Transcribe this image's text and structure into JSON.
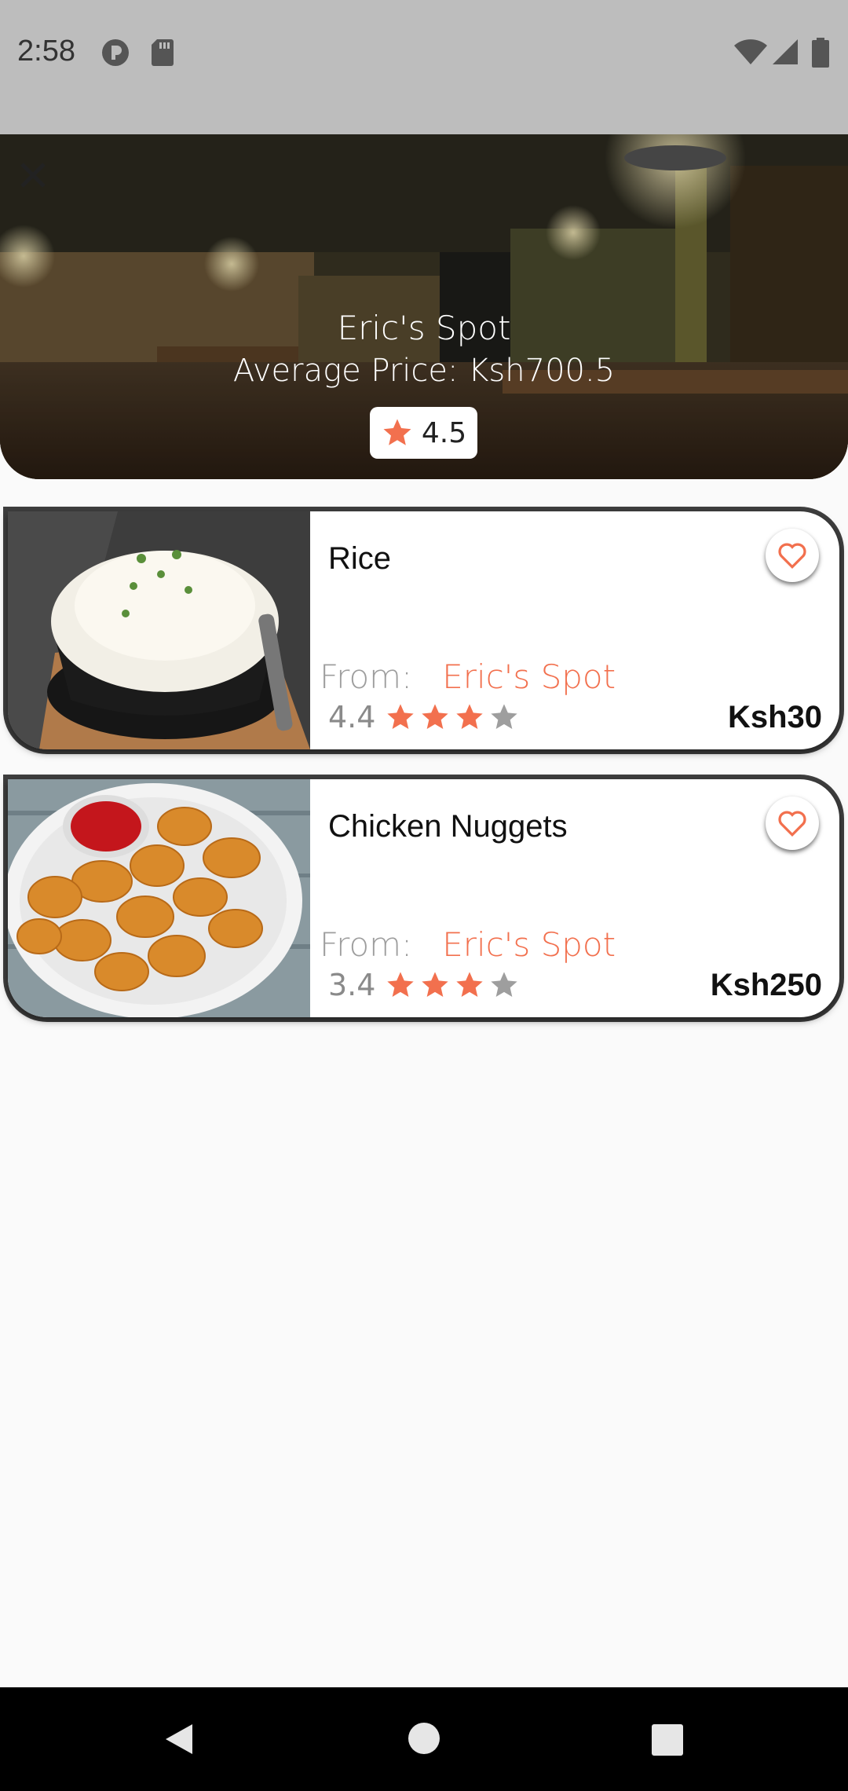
{
  "status_bar": {
    "time": "2:58",
    "icons_left": [
      "data-saver-icon",
      "sd-card-icon"
    ],
    "icons_right": [
      "wifi-icon",
      "signal-icon",
      "battery-icon"
    ]
  },
  "restaurant": {
    "name": "Eric's Spot",
    "average_price": "Average Price: Ksh700.5",
    "rating": "4.5"
  },
  "menu_items": [
    {
      "name": "Rice",
      "from_label": "From:",
      "from_restaurant": "Eric's Spot",
      "rating": "4.4",
      "stars_filled": 3,
      "stars_total": 4,
      "price": "Ksh30"
    },
    {
      "name": "Chicken Nuggets",
      "from_label": "From:",
      "from_restaurant": "Eric's Spot",
      "rating": "3.4",
      "stars_filled": 3,
      "stars_total": 4,
      "price": "Ksh250"
    }
  ],
  "colors": {
    "accent": "#f2704e",
    "status_bar": "#bdbdbd",
    "background": "#fafafa"
  },
  "nav_bar": {
    "buttons": [
      "back-icon",
      "home-icon",
      "recents-icon"
    ]
  }
}
